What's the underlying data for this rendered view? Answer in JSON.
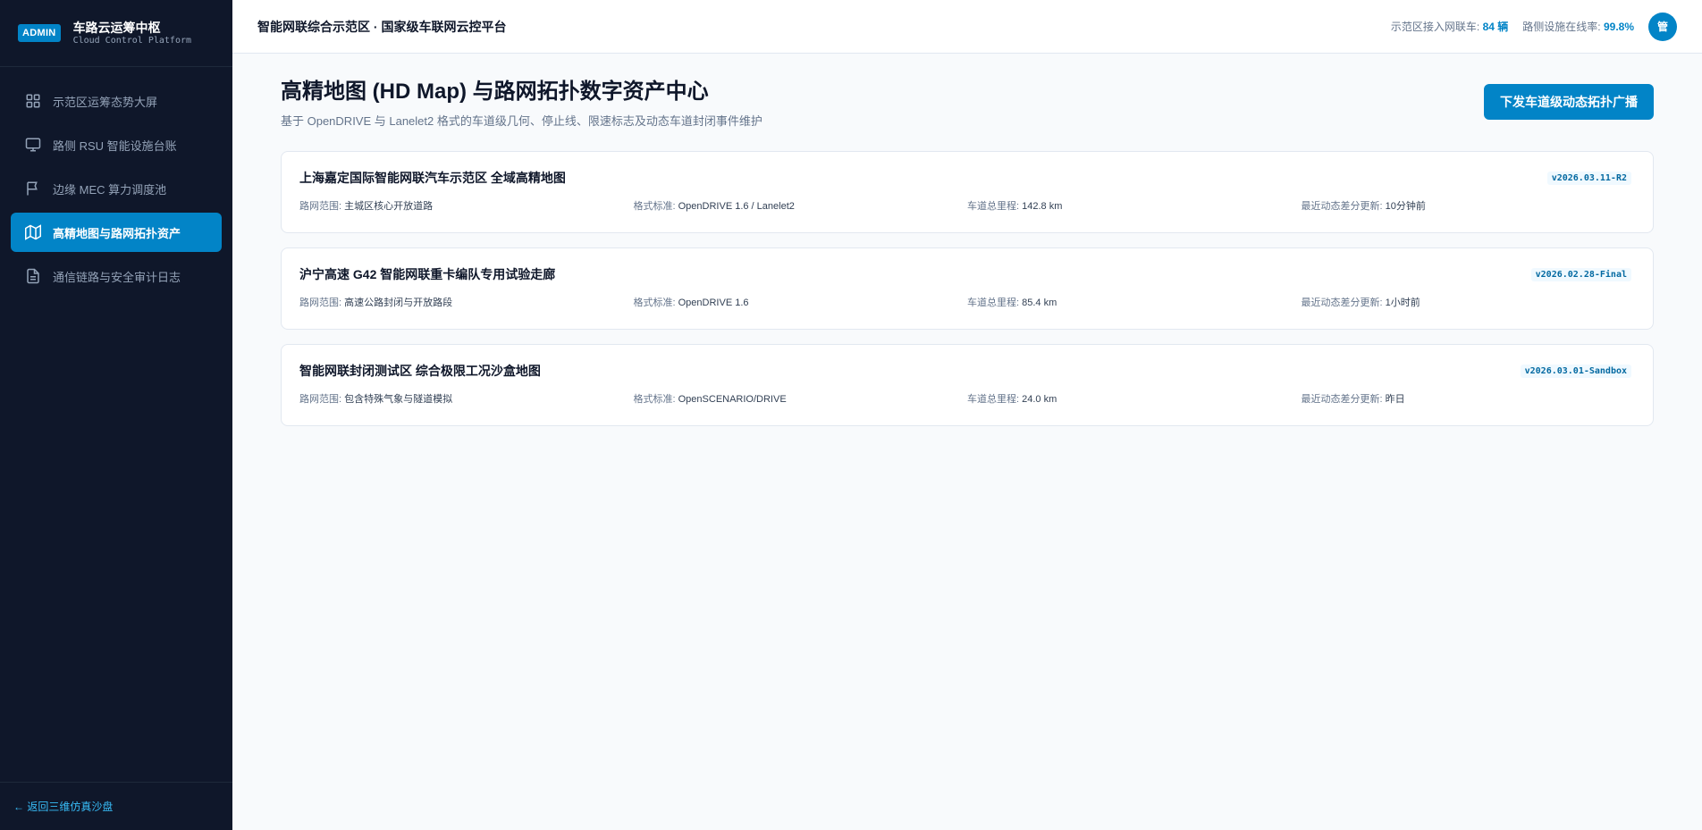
{
  "brand": {
    "badge": "ADMIN",
    "title": "车路云运筹中枢",
    "subtitle": "Cloud Control Platform"
  },
  "nav": {
    "items": [
      {
        "label": "示范区运筹态势大屏",
        "icon": "grid-icon"
      },
      {
        "label": "路侧 RSU 智能设施台账",
        "icon": "monitor-icon"
      },
      {
        "label": "边缘 MEC 算力调度池",
        "icon": "flag-icon"
      },
      {
        "label": "高精地图与路网拓扑资产",
        "icon": "map-icon",
        "active": true
      },
      {
        "label": "通信链路与安全审计日志",
        "icon": "document-icon"
      }
    ],
    "back_label": "← 返回三维仿真沙盘"
  },
  "header": {
    "title": "智能网联综合示范区 · 国家级车联网云控平台",
    "stats": [
      {
        "label": "示范区接入网联车:",
        "value": "84 辆"
      },
      {
        "label": "路侧设施在线率:",
        "value": "99.8%"
      }
    ],
    "avatar": "管"
  },
  "page": {
    "title": "高精地图 (HD Map) 与路网拓扑数字资产中心",
    "subtitle": "基于 OpenDRIVE 与 Lanelet2 格式的车道级几何、停止线、限速标志及动态车道封闭事件维护",
    "action_label": "下发车道级动态拓扑广播"
  },
  "meta_labels": {
    "scope": "路网范围:",
    "format": "格式标准:",
    "mileage": "车道总里程:",
    "update": "最近动态差分更新:"
  },
  "maps": [
    {
      "title": "上海嘉定国际智能网联汽车示范区 全域高精地图",
      "version": "v2026.03.11-R2",
      "scope": "主城区核心开放道路",
      "format": "OpenDRIVE 1.6 / Lanelet2",
      "mileage": "142.8 km",
      "update": "10分钟前"
    },
    {
      "title": "沪宁高速 G42 智能网联重卡编队专用试验走廊",
      "version": "v2026.02.28-Final",
      "scope": "高速公路封闭与开放路段",
      "format": "OpenDRIVE 1.6",
      "mileage": "85.4 km",
      "update": "1小时前"
    },
    {
      "title": "智能网联封闭测试区 综合极限工况沙盒地图",
      "version": "v2026.03.01-Sandbox",
      "scope": "包含特殊气象与隧道模拟",
      "format": "OpenSCENARIO/DRIVE",
      "mileage": "24.0 km",
      "update": "昨日"
    }
  ],
  "colors": {
    "sidebar_bg": "#0f172a",
    "accent": "#0284c7",
    "page_bg": "#f8fafc"
  }
}
